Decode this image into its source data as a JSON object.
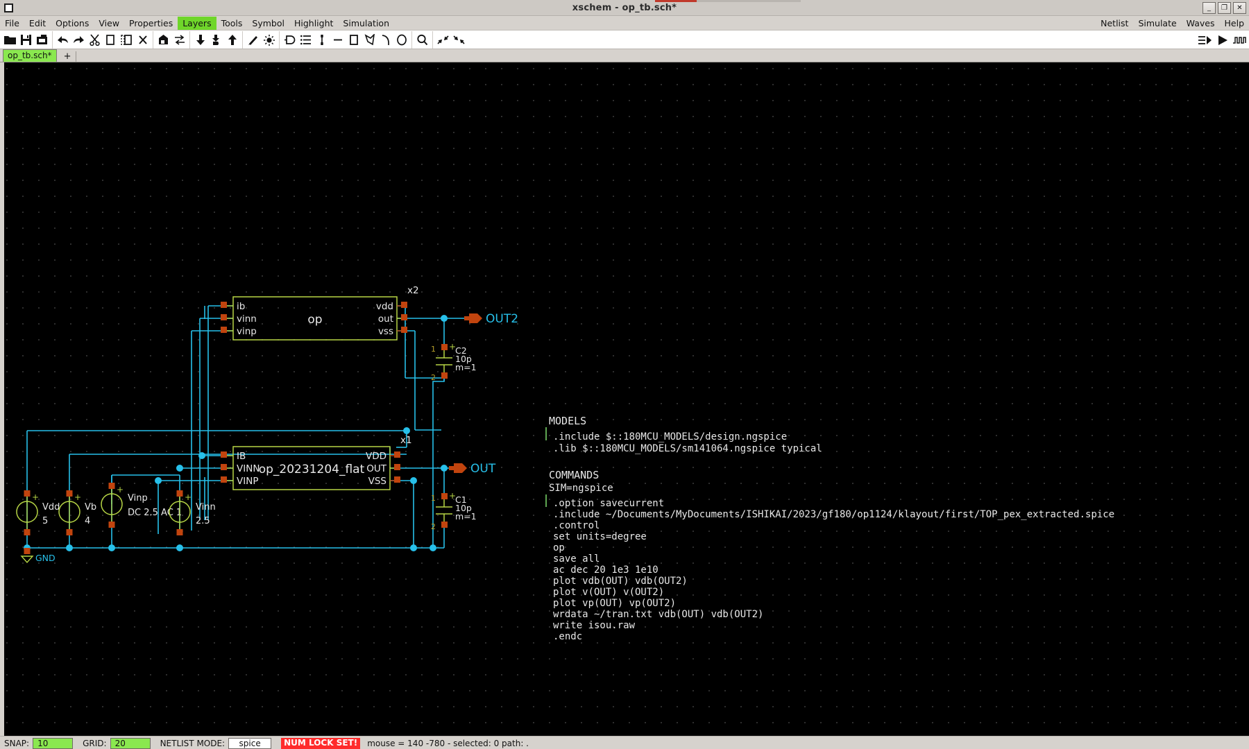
{
  "window": {
    "title": "xschem - op_tb.sch*",
    "minimize": "_",
    "maximize": "❐",
    "close": "✕"
  },
  "menubar": {
    "items": [
      {
        "label": "File",
        "highlighted": false
      },
      {
        "label": "Edit",
        "highlighted": false
      },
      {
        "label": "Options",
        "highlighted": false
      },
      {
        "label": "View",
        "highlighted": false
      },
      {
        "label": "Properties",
        "highlighted": false
      },
      {
        "label": "Layers",
        "highlighted": true
      },
      {
        "label": "Tools",
        "highlighted": false
      },
      {
        "label": "Symbol",
        "highlighted": false
      },
      {
        "label": "Highlight",
        "highlighted": false
      },
      {
        "label": "Simulation",
        "highlighted": false
      }
    ],
    "right_items": [
      {
        "label": "Netlist"
      },
      {
        "label": "Simulate"
      },
      {
        "label": "Waves"
      },
      {
        "label": "Help"
      }
    ]
  },
  "toolbar": {
    "buttons": [
      {
        "name": "open-file-icon"
      },
      {
        "name": "save-file-icon"
      },
      {
        "name": "save-as-icon"
      },
      {
        "name": "undo-icon"
      },
      {
        "name": "redo-icon"
      },
      {
        "name": "cut-icon"
      },
      {
        "name": "copy-icon"
      },
      {
        "name": "paste-icon"
      },
      {
        "name": "delete-icon"
      },
      {
        "name": "push-schematic-icon"
      },
      {
        "name": "swap-symbol-icon"
      },
      {
        "name": "descend-icon"
      },
      {
        "name": "descend-symbol-icon"
      },
      {
        "name": "ascend-icon"
      },
      {
        "name": "edit-attributes-icon"
      },
      {
        "name": "highlight-net-icon"
      },
      {
        "name": "insert-symbol-icon"
      },
      {
        "name": "insert-text-icon"
      },
      {
        "name": "insert-pin-icon"
      },
      {
        "name": "insert-wire-icon"
      },
      {
        "name": "insert-rectangle-icon"
      },
      {
        "name": "insert-polygon-icon"
      },
      {
        "name": "insert-arc-icon"
      },
      {
        "name": "insert-circle-icon"
      },
      {
        "name": "zoom-icon"
      },
      {
        "name": "zoom-fit-icon"
      },
      {
        "name": "zoom-full-icon"
      }
    ],
    "right_buttons": [
      {
        "name": "netlist-run-icon"
      },
      {
        "name": "simulate-run-icon"
      },
      {
        "name": "waves-view-icon"
      }
    ]
  },
  "tabbar": {
    "tabs": [
      {
        "label": "op_tb.sch*",
        "active": true
      }
    ],
    "add_label": "+"
  },
  "schematic": {
    "symbols": [
      {
        "instance": "x2",
        "name": "op",
        "left_pins": [
          "ib",
          "vinn",
          "vinp"
        ],
        "right_pins": [
          "vdd",
          "out",
          "vss"
        ]
      },
      {
        "instance": "x1",
        "name": "op_20231204_flat",
        "left_pins": [
          "IB",
          "VINN",
          "VINP"
        ],
        "right_pins": [
          "VDD",
          "OUT",
          "VSS"
        ]
      }
    ],
    "capacitors": [
      {
        "ref": "C2",
        "value": "10p",
        "mult": "m=1",
        "pin1": "1",
        "pin2": "2",
        "plus": "+"
      },
      {
        "ref": "C1",
        "value": "10p",
        "mult": "m=1",
        "pin1": "1",
        "pin2": "2",
        "plus": "+"
      }
    ],
    "sources": [
      {
        "ref": "Vdd",
        "value": "5",
        "plus": "+"
      },
      {
        "ref": "Vb",
        "value": "4",
        "plus": "+"
      },
      {
        "ref": "Vinp",
        "value": "DC 2.5 AC 1",
        "plus": "+"
      },
      {
        "ref": "Vinn",
        "value": "2.5",
        "plus": "+"
      }
    ],
    "ground_label": "GND",
    "out_labels": [
      "OUT2",
      "OUT"
    ],
    "models_block": {
      "title": "MODELS",
      "lines": [
        ".include $::180MCU_MODELS/design.ngspice",
        ".lib $::180MCU_MODELS/sm141064.ngspice typical"
      ]
    },
    "commands_block": {
      "title": "COMMANDS",
      "sim": "SIM=ngspice",
      "lines": [
        ".option savecurrent",
        ".include ~/Documents/MyDocuments/ISHIKAI/2023/gf180/op1124/klayout/first/TOP_pex_extracted.spice",
        ".control",
        "set units=degree",
        "op",
        "save all",
        "ac dec 20 1e3 1e10",
        "plot   vdb(OUT)  vdb(OUT2)",
        "plot   v(OUT) v(OUT2)",
        "plot   vp(OUT) vp(OUT2)",
        "wrdata ~/tran.txt vdb(OUT) vdb(OUT2)",
        "write isou.raw",
        ".endc"
      ]
    },
    "colors": {
      "wire": "#27c0ea",
      "symbol_outline": "#b7d645",
      "pin_square": "#c1440e",
      "text_white": "#e8e8e8",
      "label_cyan": "#27c0ea",
      "label_arrow": "#c1440e",
      "background": "#000000"
    }
  },
  "statusbar": {
    "snap_label": "SNAP:",
    "snap_value": "10",
    "grid_label": "GRID:",
    "grid_value": "20",
    "netlist_mode_label": "NETLIST MODE:",
    "netlist_mode_value": "spice",
    "numlock": "NUM LOCK SET!",
    "mouse": "mouse = 140 -780 - selected: 0 path: ."
  }
}
